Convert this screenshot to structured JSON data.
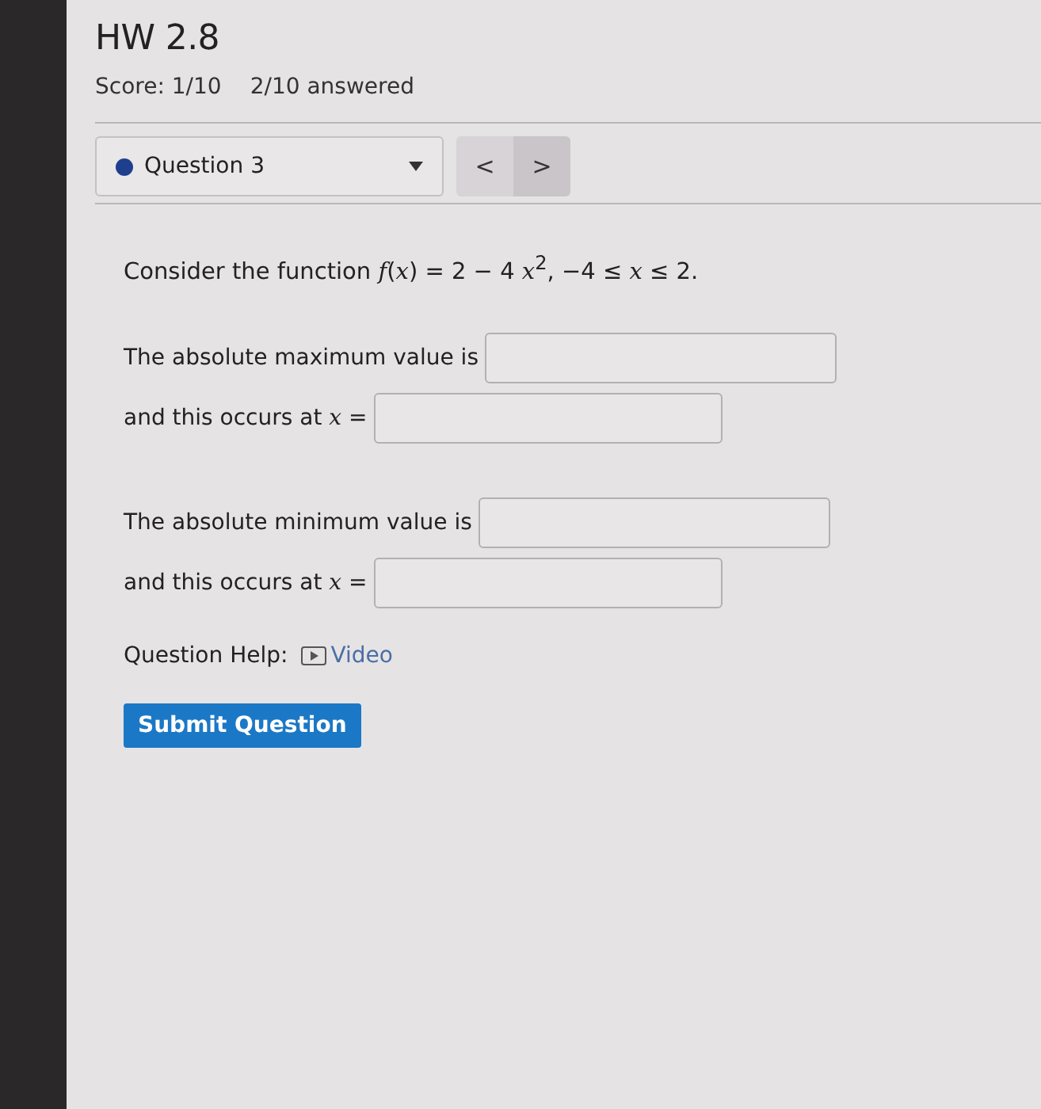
{
  "title": "HW 2.8",
  "score": "Score: 1/10",
  "answered": "2/10 answered",
  "question_select": {
    "label": "Question 3"
  },
  "nav": [
    {
      "label": "<"
    },
    {
      "label": ">"
    }
  ],
  "prompt": "Consider the function *f*(*x*) = 2 − 4 *x*$^{2}$,   −4 ≤ *x* ≤ 2.",
  "groups": [
    [
      {
        "label": "The absolute maximum value is"
      },
      {
        "label": "and this occurs at *x* ="
      }
    ],
    [
      {
        "label": "The absolute minimum value is"
      },
      {
        "label": "and this occurs at *x* ="
      }
    ]
  ],
  "help": {
    "label": "Question Help:",
    "link": "Video"
  },
  "submit": "Submit Question"
}
